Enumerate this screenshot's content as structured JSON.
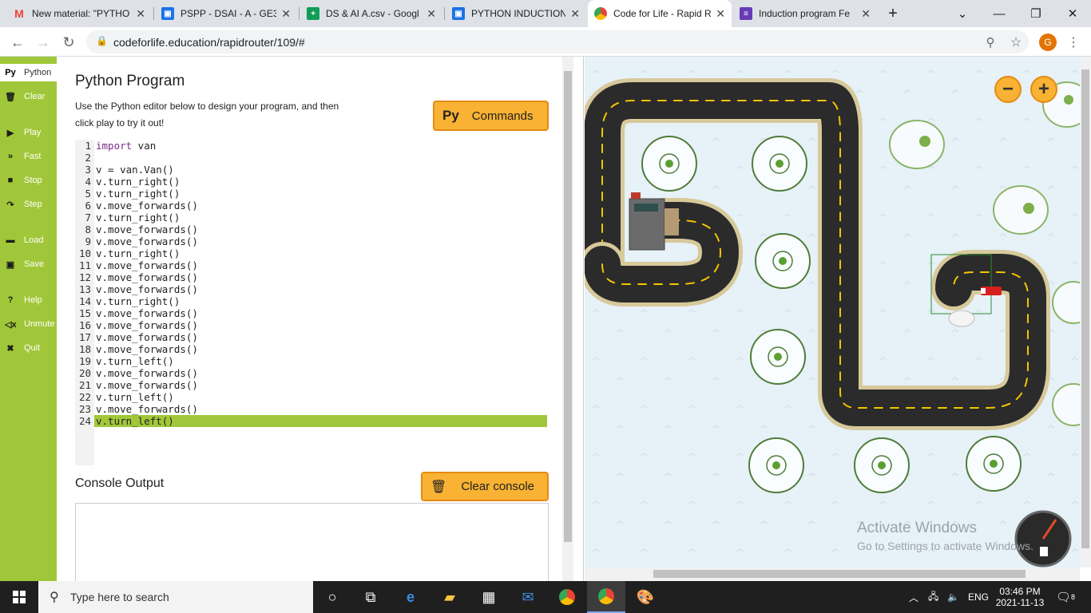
{
  "browser": {
    "tabs": [
      {
        "title": "New material: \"PYTHO",
        "icon": "gmail-icon",
        "color": "#ea4335"
      },
      {
        "title": "PSPP - DSAI - A - GE3",
        "icon": "classroom-icon",
        "color": "#1a73e8"
      },
      {
        "title": "DS & AI A.csv - Googl",
        "icon": "sheets-icon",
        "color": "#0f9d58"
      },
      {
        "title": "PYTHON INDUCTION",
        "icon": "classroom-icon",
        "color": "#1a73e8"
      },
      {
        "title": "Code for Life - Rapid R",
        "icon": "codeforlife-icon",
        "color": "#e8453c",
        "active": true
      },
      {
        "title": "Induction program Fe",
        "icon": "forms-icon",
        "color": "#673ab7"
      }
    ],
    "url": "codeforlife.education/rapidrouter/109/#",
    "profile_initial": "G"
  },
  "sidebar": {
    "items": [
      {
        "label": "Python",
        "icon": "python-icon",
        "glyph": "Py"
      },
      {
        "label": "Clear",
        "icon": "trash-icon",
        "glyph": "🗑"
      },
      {
        "label": "Play",
        "icon": "play-icon",
        "glyph": "▶"
      },
      {
        "label": "Fast",
        "icon": "fast-forward-icon",
        "glyph": "⏩"
      },
      {
        "label": "Stop",
        "icon": "stop-icon",
        "glyph": "■"
      },
      {
        "label": "Step",
        "icon": "step-icon",
        "glyph": "↷"
      },
      {
        "label": "Load",
        "icon": "folder-icon",
        "glyph": "▬"
      },
      {
        "label": "Save",
        "icon": "save-icon",
        "glyph": "💾"
      },
      {
        "label": "Help",
        "icon": "help-icon",
        "glyph": "?"
      },
      {
        "label": "Unmute",
        "icon": "mute-icon",
        "glyph": "🔇"
      },
      {
        "label": "Quit",
        "icon": "quit-icon",
        "glyph": "✖"
      }
    ]
  },
  "editor": {
    "title": "Python Program",
    "description": "Use the Python editor below to design your program, and then click play to try it out!",
    "commands_button": "Commands",
    "commands_py": "Py",
    "code_lines": [
      "import van",
      "",
      "v = van.Van()",
      "v.turn_right()",
      "v.turn_right()",
      "v.move_forwards()",
      "v.turn_right()",
      "v.move_forwards()",
      "v.move_forwards()",
      "v.turn_right()",
      "v.move_forwards()",
      "v.move_forwards()",
      "v.move_forwards()",
      "v.turn_right()",
      "v.move_forwards()",
      "v.move_forwards()",
      "v.move_forwards()",
      "v.move_forwards()",
      "v.turn_left()",
      "v.move_forwards()",
      "v.move_forwards()",
      "v.turn_left()",
      "v.move_forwards()",
      "v.turn_left()"
    ],
    "highlighted_line": 24,
    "console_title": "Console Output",
    "clear_console_button": "Clear console"
  },
  "game": {
    "zoom_out": "−",
    "zoom_in": "+",
    "watermark_title": "Activate Windows",
    "watermark_sub": "Go to Settings to activate Windows."
  },
  "taskbar": {
    "search_placeholder": "Type here to search",
    "language": "ENG",
    "time": "03:46 PM",
    "date": "2021-11-13",
    "notifications": "8"
  }
}
